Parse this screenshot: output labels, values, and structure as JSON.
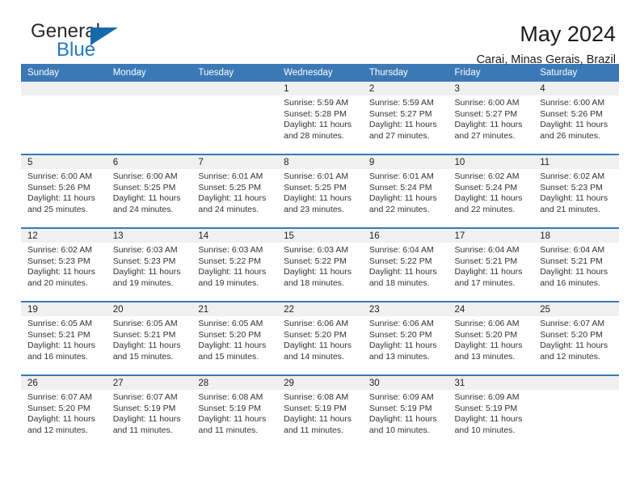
{
  "logo": {
    "text_primary": "General",
    "text_secondary": "Blue",
    "triangle_color": "#1769ad",
    "blue_color": "#1f7ac4"
  },
  "header": {
    "title": "May 2024",
    "subtitle": "Carai, Minas Gerais, Brazil"
  },
  "theme": {
    "header_row_bg": "#3b78b6",
    "daynum_bg": "#f0f0f0",
    "row_divider": "#3b78b6"
  },
  "weekday_headers": [
    "Sunday",
    "Monday",
    "Tuesday",
    "Wednesday",
    "Thursday",
    "Friday",
    "Saturday"
  ],
  "weeks": [
    [
      {
        "day": "",
        "empty": true
      },
      {
        "day": "",
        "empty": true
      },
      {
        "day": "",
        "empty": true
      },
      {
        "day": "1",
        "sunrise": "Sunrise: 5:59 AM",
        "sunset": "Sunset: 5:28 PM",
        "daylight_1": "Daylight: 11 hours",
        "daylight_2": "and 28 minutes."
      },
      {
        "day": "2",
        "sunrise": "Sunrise: 5:59 AM",
        "sunset": "Sunset: 5:27 PM",
        "daylight_1": "Daylight: 11 hours",
        "daylight_2": "and 27 minutes."
      },
      {
        "day": "3",
        "sunrise": "Sunrise: 6:00 AM",
        "sunset": "Sunset: 5:27 PM",
        "daylight_1": "Daylight: 11 hours",
        "daylight_2": "and 27 minutes."
      },
      {
        "day": "4",
        "sunrise": "Sunrise: 6:00 AM",
        "sunset": "Sunset: 5:26 PM",
        "daylight_1": "Daylight: 11 hours",
        "daylight_2": "and 26 minutes."
      }
    ],
    [
      {
        "day": "5",
        "sunrise": "Sunrise: 6:00 AM",
        "sunset": "Sunset: 5:26 PM",
        "daylight_1": "Daylight: 11 hours",
        "daylight_2": "and 25 minutes."
      },
      {
        "day": "6",
        "sunrise": "Sunrise: 6:00 AM",
        "sunset": "Sunset: 5:25 PM",
        "daylight_1": "Daylight: 11 hours",
        "daylight_2": "and 24 minutes."
      },
      {
        "day": "7",
        "sunrise": "Sunrise: 6:01 AM",
        "sunset": "Sunset: 5:25 PM",
        "daylight_1": "Daylight: 11 hours",
        "daylight_2": "and 24 minutes."
      },
      {
        "day": "8",
        "sunrise": "Sunrise: 6:01 AM",
        "sunset": "Sunset: 5:25 PM",
        "daylight_1": "Daylight: 11 hours",
        "daylight_2": "and 23 minutes."
      },
      {
        "day": "9",
        "sunrise": "Sunrise: 6:01 AM",
        "sunset": "Sunset: 5:24 PM",
        "daylight_1": "Daylight: 11 hours",
        "daylight_2": "and 22 minutes."
      },
      {
        "day": "10",
        "sunrise": "Sunrise: 6:02 AM",
        "sunset": "Sunset: 5:24 PM",
        "daylight_1": "Daylight: 11 hours",
        "daylight_2": "and 22 minutes."
      },
      {
        "day": "11",
        "sunrise": "Sunrise: 6:02 AM",
        "sunset": "Sunset: 5:23 PM",
        "daylight_1": "Daylight: 11 hours",
        "daylight_2": "and 21 minutes."
      }
    ],
    [
      {
        "day": "12",
        "sunrise": "Sunrise: 6:02 AM",
        "sunset": "Sunset: 5:23 PM",
        "daylight_1": "Daylight: 11 hours",
        "daylight_2": "and 20 minutes."
      },
      {
        "day": "13",
        "sunrise": "Sunrise: 6:03 AM",
        "sunset": "Sunset: 5:23 PM",
        "daylight_1": "Daylight: 11 hours",
        "daylight_2": "and 19 minutes."
      },
      {
        "day": "14",
        "sunrise": "Sunrise: 6:03 AM",
        "sunset": "Sunset: 5:22 PM",
        "daylight_1": "Daylight: 11 hours",
        "daylight_2": "and 19 minutes."
      },
      {
        "day": "15",
        "sunrise": "Sunrise: 6:03 AM",
        "sunset": "Sunset: 5:22 PM",
        "daylight_1": "Daylight: 11 hours",
        "daylight_2": "and 18 minutes."
      },
      {
        "day": "16",
        "sunrise": "Sunrise: 6:04 AM",
        "sunset": "Sunset: 5:22 PM",
        "daylight_1": "Daylight: 11 hours",
        "daylight_2": "and 18 minutes."
      },
      {
        "day": "17",
        "sunrise": "Sunrise: 6:04 AM",
        "sunset": "Sunset: 5:21 PM",
        "daylight_1": "Daylight: 11 hours",
        "daylight_2": "and 17 minutes."
      },
      {
        "day": "18",
        "sunrise": "Sunrise: 6:04 AM",
        "sunset": "Sunset: 5:21 PM",
        "daylight_1": "Daylight: 11 hours",
        "daylight_2": "and 16 minutes."
      }
    ],
    [
      {
        "day": "19",
        "sunrise": "Sunrise: 6:05 AM",
        "sunset": "Sunset: 5:21 PM",
        "daylight_1": "Daylight: 11 hours",
        "daylight_2": "and 16 minutes."
      },
      {
        "day": "20",
        "sunrise": "Sunrise: 6:05 AM",
        "sunset": "Sunset: 5:21 PM",
        "daylight_1": "Daylight: 11 hours",
        "daylight_2": "and 15 minutes."
      },
      {
        "day": "21",
        "sunrise": "Sunrise: 6:05 AM",
        "sunset": "Sunset: 5:20 PM",
        "daylight_1": "Daylight: 11 hours",
        "daylight_2": "and 15 minutes."
      },
      {
        "day": "22",
        "sunrise": "Sunrise: 6:06 AM",
        "sunset": "Sunset: 5:20 PM",
        "daylight_1": "Daylight: 11 hours",
        "daylight_2": "and 14 minutes."
      },
      {
        "day": "23",
        "sunrise": "Sunrise: 6:06 AM",
        "sunset": "Sunset: 5:20 PM",
        "daylight_1": "Daylight: 11 hours",
        "daylight_2": "and 13 minutes."
      },
      {
        "day": "24",
        "sunrise": "Sunrise: 6:06 AM",
        "sunset": "Sunset: 5:20 PM",
        "daylight_1": "Daylight: 11 hours",
        "daylight_2": "and 13 minutes."
      },
      {
        "day": "25",
        "sunrise": "Sunrise: 6:07 AM",
        "sunset": "Sunset: 5:20 PM",
        "daylight_1": "Daylight: 11 hours",
        "daylight_2": "and 12 minutes."
      }
    ],
    [
      {
        "day": "26",
        "sunrise": "Sunrise: 6:07 AM",
        "sunset": "Sunset: 5:20 PM",
        "daylight_1": "Daylight: 11 hours",
        "daylight_2": "and 12 minutes."
      },
      {
        "day": "27",
        "sunrise": "Sunrise: 6:07 AM",
        "sunset": "Sunset: 5:19 PM",
        "daylight_1": "Daylight: 11 hours",
        "daylight_2": "and 11 minutes."
      },
      {
        "day": "28",
        "sunrise": "Sunrise: 6:08 AM",
        "sunset": "Sunset: 5:19 PM",
        "daylight_1": "Daylight: 11 hours",
        "daylight_2": "and 11 minutes."
      },
      {
        "day": "29",
        "sunrise": "Sunrise: 6:08 AM",
        "sunset": "Sunset: 5:19 PM",
        "daylight_1": "Daylight: 11 hours",
        "daylight_2": "and 11 minutes."
      },
      {
        "day": "30",
        "sunrise": "Sunrise: 6:09 AM",
        "sunset": "Sunset: 5:19 PM",
        "daylight_1": "Daylight: 11 hours",
        "daylight_2": "and 10 minutes."
      },
      {
        "day": "31",
        "sunrise": "Sunrise: 6:09 AM",
        "sunset": "Sunset: 5:19 PM",
        "daylight_1": "Daylight: 11 hours",
        "daylight_2": "and 10 minutes."
      },
      {
        "day": "",
        "empty": true
      }
    ]
  ]
}
